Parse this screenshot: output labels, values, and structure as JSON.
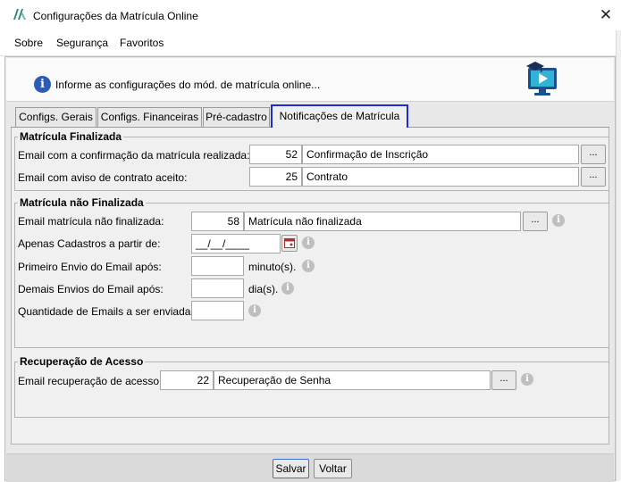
{
  "window": {
    "title": "Configurações da Matrícula Online",
    "close_glyph": "✕",
    "icon": "app-logo-icon"
  },
  "menu": {
    "items": [
      {
        "label": "Sobre"
      },
      {
        "label": "Segurança"
      },
      {
        "label": "Favoritos"
      }
    ]
  },
  "header": {
    "text": "Informe as configurações do mód. de matrícula online...",
    "info_glyph": "i"
  },
  "tabs": [
    {
      "label": "Configs. Gerais"
    },
    {
      "label": "Configs. Financeiras"
    },
    {
      "label": "Pré-cadastro"
    },
    {
      "label": "Notificações de Matrícula",
      "active": true
    }
  ],
  "finalizada": {
    "title": "Matrícula Finalizada",
    "rows": [
      {
        "label": "Email com a confirmação da matrícula realizada:",
        "code": "52",
        "name": "Confirmação de Inscrição",
        "button": "..."
      },
      {
        "label": "Email com aviso de contrato aceito:",
        "code": "25",
        "name": "Contrato",
        "button": "..."
      }
    ]
  },
  "nao_finalizada": {
    "title": "Matrícula não Finalizada",
    "email_label": "Email matrícula não finalizada:",
    "email_code": "58",
    "email_name": "Matrícula não finalizada",
    "email_button": "...",
    "apenas_label": "Apenas Cadastros a partir de:",
    "apenas_value": "__/__/____",
    "primeiro_label": "Primeiro Envio do Email após:",
    "primeiro_value": "",
    "primeiro_unit": "minuto(s).",
    "demais_label": "Demais Envios do Email após:",
    "demais_value": "",
    "demais_unit": "dia(s).",
    "quantidade_label": "Quantidade de Emails a ser enviada:",
    "quantidade_value": "",
    "info_glyph": "i"
  },
  "recuperacao": {
    "title": "Recuperação de Acesso",
    "label": "Email recuperação de acesso:",
    "code": "22",
    "name": "Recuperação de Senha",
    "button": "..."
  },
  "footer": {
    "save_label": "Salvar",
    "back_label": "Voltar"
  },
  "colors": {
    "active_tab_border": "#1d2bd6",
    "info_blue": "#2d5db3"
  }
}
